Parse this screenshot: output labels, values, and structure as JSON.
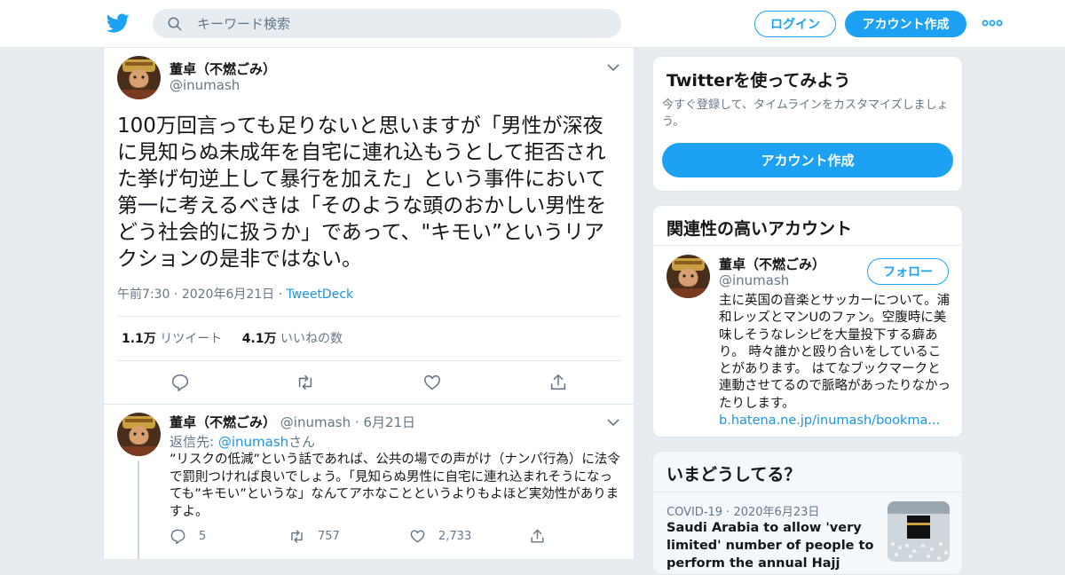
{
  "search": {
    "placeholder": "キーワード検索"
  },
  "header": {
    "login_label": "ログイン",
    "signup_label": "アカウント作成"
  },
  "tweet": {
    "name": "董卓（不燃ごみ）",
    "handle": "@inumash",
    "text": "100万回言っても足りないと思いますが「男性が深夜に見知らぬ未成年を自宅に連れ込もうとして拒否された挙げ句逆上して暴行を加えた」という事件において第一に考えるべきは「そのような頭のおかしい男性をどう社会的に扱うか」であって、\"キモい”というリアクションの是非ではない。",
    "time": "午前7:30",
    "date": "2020年6月21日",
    "source": "TweetDeck",
    "retweet_count": "1.1万",
    "retweet_label": "リツイート",
    "like_count": "4.1万",
    "like_label": "いいねの数"
  },
  "reply": {
    "name": "董卓（不燃ごみ）",
    "handle": "@inumash",
    "date": "6月21日",
    "reply_to_prefix": "返信先: ",
    "reply_to_handle": "@inumash",
    "reply_to_suffix": "さん",
    "text": "”リスクの低減”という話であれば、公共の場での声がけ（ナンパ行為）に法令で罰則つければ良いでしょう。「見知らぬ男性に自宅に連れ込まれそうになっても”キモい”というな」なんてアホなことというよりもよほど実効性がありますよ。",
    "reply_count": "5",
    "retweet_count": "757",
    "like_count": "2,733"
  },
  "sidebar": {
    "try_title": "Twitterを使ってみよう",
    "try_sub": "今すぐ登録して、タイムラインをカスタマイズしましょう。",
    "try_button": "アカウント作成",
    "related_title": "関連性の高いアカウント",
    "related_name": "董卓（不燃ごみ）",
    "related_handle": "@inumash",
    "follow_label": "フォロー",
    "related_bio": "主に英国の音楽とサッカーについて。浦和レッズとマンUのファン。空腹時に美味しそうなレシピを大量投下する癖あり。 時々誰かと殴り合いをしていることがあります。 はてなブックマークと連動させてるので脈略があったりなかったりします。",
    "related_link": "b.hatena.ne.jp/inumash/bookma...",
    "trends_title": "いまどうしてる？",
    "trend_category": "COVID-19",
    "trend_date": "2020年6月23日",
    "trend_headline": "Saudi Arabia to allow 'very limited' number of people to perform the annual Hajj pilgrimage"
  },
  "colors": {
    "accent": "#1da1f2",
    "link": "#1b95e0",
    "muted": "#657786",
    "background": "#e6ecf0"
  }
}
